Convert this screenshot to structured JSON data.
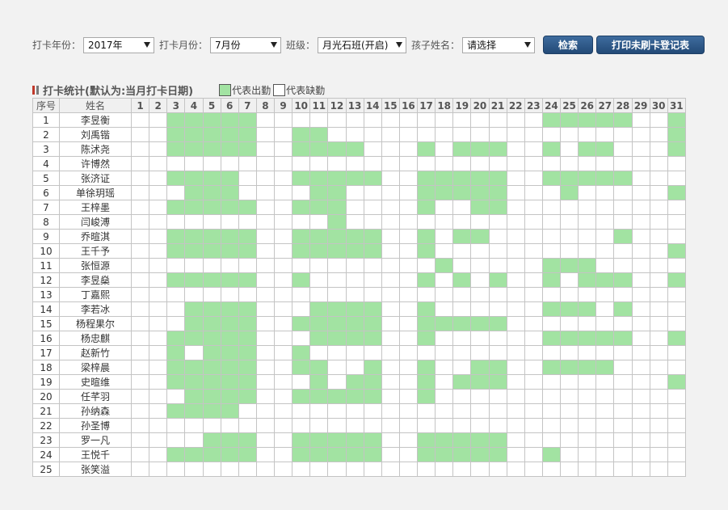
{
  "filters": {
    "year_label": "打卡年份：",
    "year_value": "2017年",
    "month_label": "打卡月份：",
    "month_value": "7月份",
    "class_label": "班级：",
    "class_value": "月光石班(开启)",
    "child_label": "孩子姓名：",
    "child_value": "请选择",
    "search_button": "检索",
    "print_button": "打印未刷卡登记表"
  },
  "section": {
    "title": "打卡统计(默认为:当月打卡日期)",
    "legend_present": "代表出勤",
    "legend_absent": "代表缺勤"
  },
  "colors": {
    "present": "#a2e3a2",
    "absent": "#ffffff",
    "button": "#2b5585"
  },
  "table": {
    "index_header": "序号",
    "name_header": "姓名",
    "days": [
      "1",
      "2",
      "3",
      "4",
      "5",
      "6",
      "7",
      "8",
      "9",
      "10",
      "11",
      "12",
      "13",
      "14",
      "15",
      "16",
      "17",
      "18",
      "19",
      "20",
      "21",
      "22",
      "23",
      "24",
      "25",
      "26",
      "27",
      "28",
      "29",
      "30",
      "31"
    ],
    "rows": [
      {
        "index": "1",
        "name": "李昱衡",
        "present": [
          3,
          4,
          5,
          6,
          7,
          24,
          25,
          26,
          27,
          28,
          31
        ]
      },
      {
        "index": "2",
        "name": "刘禹锴",
        "present": [
          3,
          4,
          5,
          6,
          7,
          10,
          11,
          31
        ]
      },
      {
        "index": "3",
        "name": "陈沭尧",
        "present": [
          3,
          4,
          5,
          6,
          7,
          10,
          11,
          12,
          13,
          17,
          19,
          20,
          21,
          24,
          26,
          27,
          31
        ]
      },
      {
        "index": "4",
        "name": "许博然",
        "present": []
      },
      {
        "index": "5",
        "name": "张济证",
        "present": [
          3,
          4,
          5,
          6,
          10,
          11,
          12,
          13,
          14,
          17,
          18,
          19,
          20,
          21,
          24,
          25,
          26,
          27,
          28
        ]
      },
      {
        "index": "6",
        "name": "单徐玥瑶",
        "present": [
          4,
          5,
          6,
          11,
          12,
          17,
          18,
          19,
          20,
          21,
          25,
          31
        ]
      },
      {
        "index": "7",
        "name": "王梓墨",
        "present": [
          3,
          4,
          5,
          6,
          7,
          10,
          11,
          12,
          17,
          20,
          21
        ]
      },
      {
        "index": "8",
        "name": "闫峻溥",
        "present": [
          12
        ]
      },
      {
        "index": "9",
        "name": "乔暄淇",
        "present": [
          3,
          4,
          5,
          6,
          7,
          10,
          11,
          12,
          13,
          14,
          17,
          19,
          20,
          28
        ]
      },
      {
        "index": "10",
        "name": "王千予",
        "present": [
          3,
          4,
          5,
          6,
          7,
          10,
          11,
          12,
          13,
          14,
          17,
          31
        ]
      },
      {
        "index": "11",
        "name": "张恒源",
        "present": [
          18,
          24,
          25,
          26
        ]
      },
      {
        "index": "12",
        "name": "李昱燊",
        "present": [
          3,
          4,
          5,
          6,
          7,
          10,
          17,
          19,
          21,
          24,
          26,
          27,
          28,
          31
        ]
      },
      {
        "index": "13",
        "name": "丁嘉熙",
        "present": []
      },
      {
        "index": "14",
        "name": "李若冰",
        "present": [
          4,
          5,
          6,
          7,
          11,
          12,
          13,
          14,
          17,
          24,
          25,
          26,
          28
        ]
      },
      {
        "index": "15",
        "name": "杨程果尔",
        "present": [
          4,
          5,
          6,
          7,
          10,
          11,
          12,
          13,
          14,
          17,
          18,
          19,
          20,
          21
        ]
      },
      {
        "index": "16",
        "name": "杨忠麒",
        "present": [
          3,
          4,
          5,
          6,
          7,
          11,
          12,
          13,
          14,
          17,
          24,
          25,
          26,
          27,
          28,
          31
        ]
      },
      {
        "index": "17",
        "name": "赵新竹",
        "present": [
          3,
          5,
          6,
          7,
          10
        ]
      },
      {
        "index": "18",
        "name": "梁梓晨",
        "present": [
          3,
          4,
          5,
          6,
          7,
          10,
          11,
          14,
          17,
          20,
          21,
          24,
          25,
          26,
          27
        ]
      },
      {
        "index": "19",
        "name": "史暄维",
        "present": [
          3,
          4,
          5,
          6,
          7,
          11,
          13,
          14,
          17,
          19,
          20,
          21,
          31
        ]
      },
      {
        "index": "20",
        "name": "任芊羽",
        "present": [
          4,
          5,
          6,
          7,
          10,
          11,
          12,
          13,
          14,
          17
        ]
      },
      {
        "index": "21",
        "name": "孙纳森",
        "present": [
          3,
          4,
          5,
          6
        ]
      },
      {
        "index": "22",
        "name": "孙圣博",
        "present": []
      },
      {
        "index": "23",
        "name": "罗一凡",
        "present": [
          5,
          6,
          7,
          10,
          11,
          12,
          13,
          14,
          17,
          18,
          19,
          20,
          21
        ]
      },
      {
        "index": "24",
        "name": "王悦千",
        "present": [
          3,
          4,
          5,
          6,
          7,
          10,
          11,
          12,
          13,
          14,
          17,
          18,
          19,
          20,
          21,
          24
        ]
      },
      {
        "index": "25",
        "name": "张笑溢",
        "present": []
      }
    ]
  }
}
